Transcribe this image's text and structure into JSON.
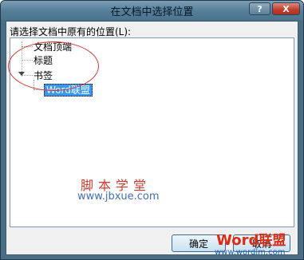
{
  "window": {
    "title": "在文档中选择位置"
  },
  "titlebar_buttons": {
    "help_glyph": "?",
    "close_glyph": "X"
  },
  "dialog": {
    "prompt": "请选择文档中原有的位置(L):",
    "tree": [
      {
        "label": "文档顶端"
      },
      {
        "label": "标题"
      },
      {
        "label": "书签",
        "expanded": true,
        "children": [
          {
            "label": "Word联盟",
            "selected": true
          }
        ]
      }
    ]
  },
  "watermark": {
    "chinese": "脚本学堂",
    "url": "www.jbxue.com"
  },
  "buttons": {
    "ok": "确定",
    "cancel": "取消"
  },
  "logo": {
    "word": "Word",
    "cn": "联盟",
    "url": "www.wordlm.com"
  },
  "colors": {
    "highlight_ring": "#e03030",
    "selection": "#3399ff"
  }
}
